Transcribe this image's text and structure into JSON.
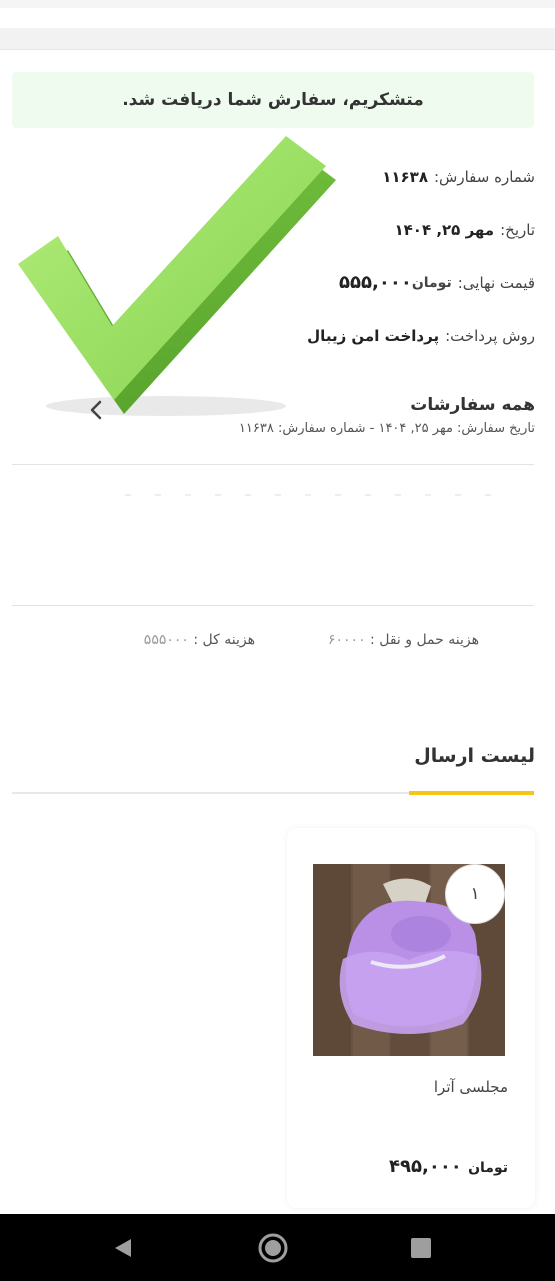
{
  "banner": {
    "message": "متشکریم، سفارش شما دریافت شد."
  },
  "order": {
    "number_label": "شماره سفارش:",
    "number_value": "۱۱۶۳۸",
    "date_label": "تاریخ:",
    "date_value": "مهر ۲۵, ۱۴۰۴",
    "total_label": "قیمت نهایی:",
    "total_currency": "تومان",
    "total_value": "۵۵۵,۰۰۰",
    "payment_label": "روش پرداخت:",
    "payment_value": "پرداخت امن زیبال"
  },
  "orders_link": {
    "title": "همه سفارشات",
    "meta": "تاریخ سفارش: مهر ۲۵, ۱۴۰۴ - شماره سفارش: ۱۱۶۳۸"
  },
  "costs": {
    "shipping_label": "هزینه حمل و نقل :",
    "shipping_value": "۶۰۰۰۰",
    "total_label": "هزینه کل :",
    "total_value": "۵۵۵۰۰۰"
  },
  "shipping_list": {
    "title": "لیست ارسال"
  },
  "product": {
    "quantity": "۱",
    "name": "مجلسی آترا",
    "price_currency": "تومان",
    "price_value": "۴۹۵,۰۰۰"
  },
  "icons": {
    "checkmark": "checkmark-icon",
    "chevron": "chevron-left-icon",
    "back": "back-icon",
    "home": "home-icon",
    "recent": "recent-apps-icon"
  },
  "colors": {
    "banner_bg": "#eefbee",
    "check_green": "#8fd65a",
    "accent_yellow": "#f5c518",
    "nav_bg": "#000000"
  }
}
